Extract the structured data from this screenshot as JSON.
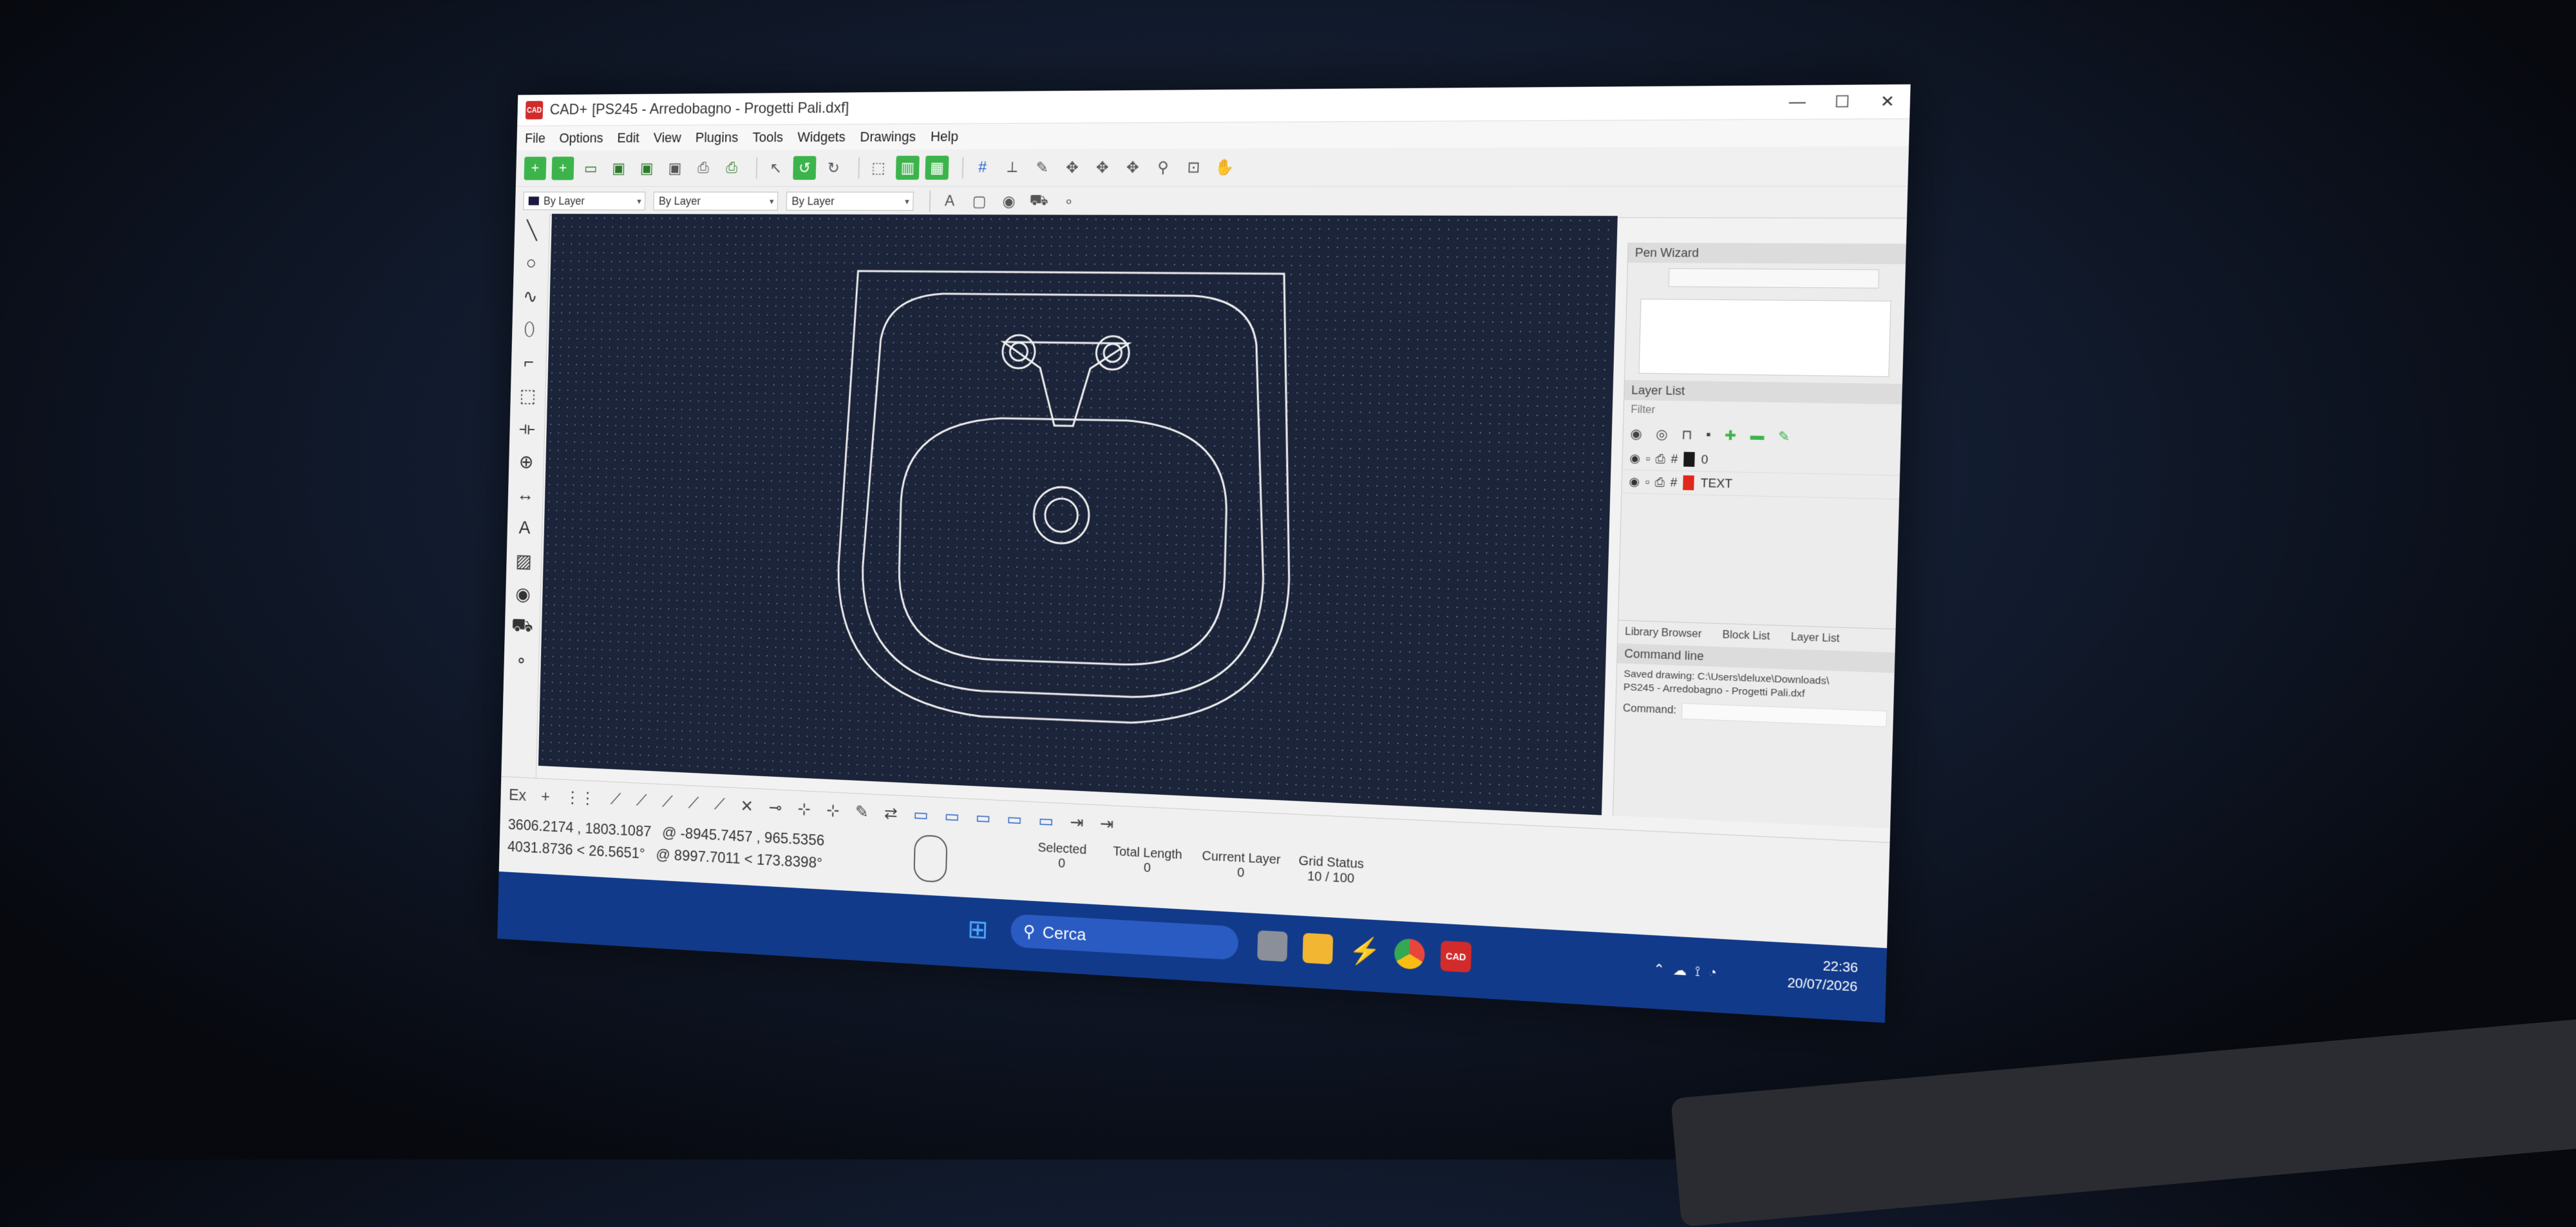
{
  "window": {
    "app_name": "CAD+",
    "document": "[PS245 - Arredobagno - Progetti Pali.dxf]",
    "controls": [
      "—",
      "☐",
      "✕"
    ]
  },
  "menu": [
    "File",
    "Options",
    "Edit",
    "View",
    "Plugins",
    "Tools",
    "Widgets",
    "Drawings",
    "Help"
  ],
  "properties": {
    "color": "By Layer",
    "linetype": "By Layer",
    "linewidth": "By Layer"
  },
  "left_tools": [
    "line-icon",
    "circle-icon",
    "spline-icon",
    "ellipse-icon",
    "polyline-icon",
    "select-icon",
    "dimension-icon",
    "snap-icon",
    "measure-icon",
    "text-icon",
    "hatch-icon",
    "camera-icon",
    "block-icon",
    "point-icon"
  ],
  "pen_wizard": {
    "title": "Pen Wizard"
  },
  "layer_list": {
    "title": "Layer List",
    "filter_placeholder": "Filter",
    "layers": [
      {
        "name": "0",
        "color": "#1a1a1a"
      },
      {
        "name": "TEXT",
        "color": "#e0281e"
      }
    ],
    "tabs": [
      "Library Browser",
      "Block List",
      "Layer List"
    ]
  },
  "command_line": {
    "title": "Command line",
    "log_line1": "Saved drawing: C:\\Users\\deluxe\\Downloads\\",
    "log_line2": "PS245 - Arredobagno - Progetti Pali.dxf",
    "prompt_label": "Command:"
  },
  "status": {
    "coord1": "3606.2174 , 1803.1087",
    "coord1_rel": "@  -8945.7457 , 965.5356",
    "coord2": "4031.8736 < 26.5651°",
    "coord2_rel": "@  8997.7011 < 173.8398°",
    "selected_label": "Selected",
    "selected_value": "0",
    "total_length_label": "Total Length",
    "total_length_value": "0",
    "current_layer_label": "Current Layer",
    "current_layer_value": "0",
    "grid_status_label": "Grid Status",
    "grid_status_value": "10 / 100",
    "snap_label": "Ex"
  },
  "taskbar": {
    "search_label": "Cerca",
    "time": "22:36",
    "date": "20/07/2026"
  }
}
